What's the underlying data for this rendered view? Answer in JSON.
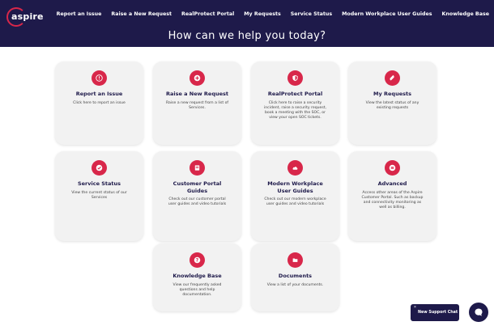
{
  "header": {
    "logo_text": "aspire",
    "nav": [
      "Report an Issue",
      "Raise a New Request",
      "RealProtect Portal",
      "My Requests",
      "Service Status",
      "Modern Workplace User Guides",
      "Knowledge Base"
    ],
    "hero_title": "How can we help you today?"
  },
  "cards": [
    {
      "title": "Report an Issue",
      "desc": "Click here to report an issue",
      "icon": "alert-icon"
    },
    {
      "title": "Raise a New Request",
      "desc": "Raise a new request from a list of Services.",
      "icon": "plus-icon"
    },
    {
      "title": "RealProtect Portal",
      "desc": "Click here to raise a security incident, raise a security request, book a meeting with the SOC, or view your open SOC tickets.",
      "icon": "shield-icon"
    },
    {
      "title": "My Requests",
      "desc": "View the latest status of any existing requests",
      "icon": "ticket-icon"
    },
    {
      "title": "Service Status",
      "desc": "View the current status of our Services",
      "icon": "check-icon"
    },
    {
      "title": "Customer Portal Guides",
      "desc": "Check out our customer portal user guides and video tutorials",
      "icon": "book-icon"
    },
    {
      "title": "Modern Workplace User Guides",
      "desc": "Check out our modern workplace user guides and video tutorials",
      "icon": "cloud-icon"
    },
    {
      "title": "Advanced",
      "desc": "Access other areas of the Aspire Customer Portal. Such as backup and connectivity monitoring as well as billing.",
      "icon": "menu-icon"
    },
    {
      "title": "Knowledge Base",
      "desc": "View our frequently asked questions and help documentation.",
      "icon": "question-icon"
    },
    {
      "title": "Documents",
      "desc": "View a list of your documents.",
      "icon": "folder-icon"
    }
  ],
  "chat": {
    "close": "×",
    "label": "New Support Chat"
  },
  "colors": {
    "header_bg": "#1e1a4a",
    "accent": "#d8274a",
    "card_bg": "#f2f2f2"
  }
}
